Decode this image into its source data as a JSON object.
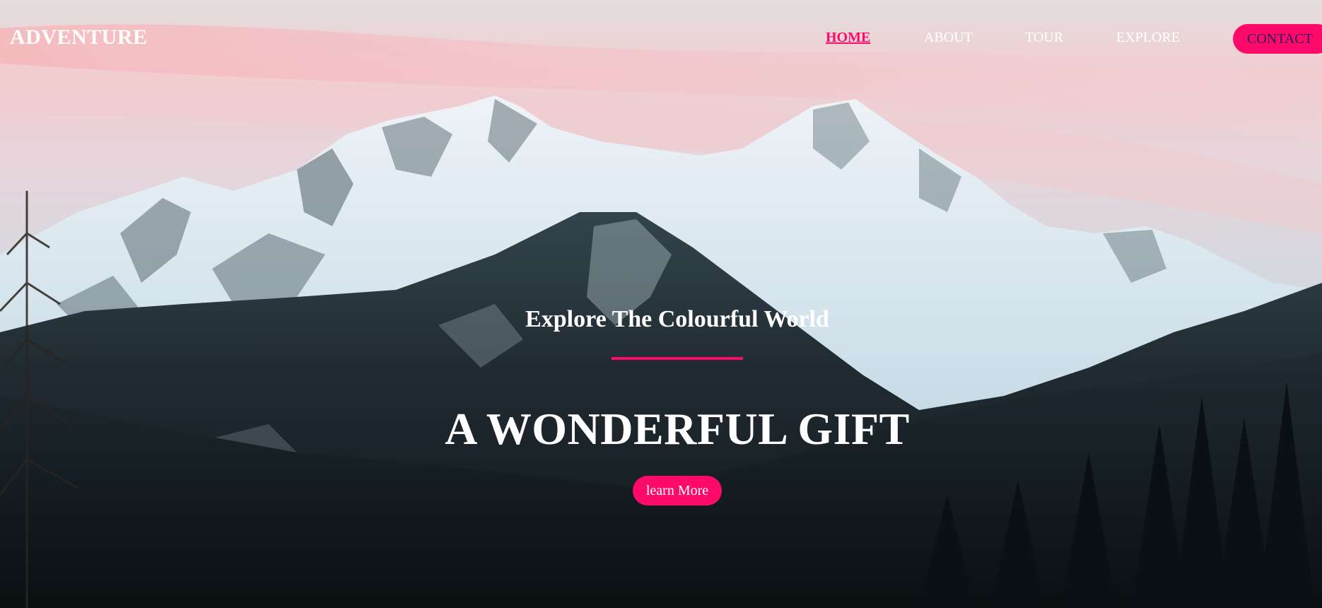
{
  "nav": {
    "logo": "ADVENTURE",
    "links": [
      {
        "label": "HOME",
        "active": true
      },
      {
        "label": "ABOUT",
        "active": false
      },
      {
        "label": "TOUR",
        "active": false
      },
      {
        "label": "EXPLORE",
        "active": false
      }
    ],
    "contact_label": "CONTACT"
  },
  "hero": {
    "subtitle": "Explore The Colourful World",
    "title": "A WONDERFUL GIFT",
    "cta_label": "learn More",
    "background": "snowy-mountain-range-at-dusk-image"
  },
  "colors": {
    "accent": "#ff0a6a",
    "text": "#ffffff",
    "contact_text": "#2a1a5e"
  }
}
